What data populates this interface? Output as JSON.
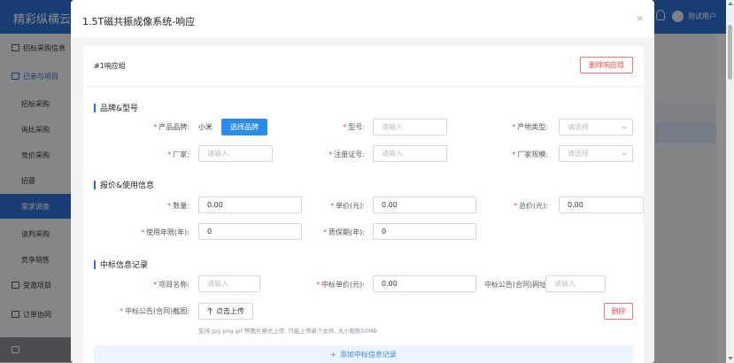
{
  "app": {
    "brand": "精彩纵横云采",
    "user": "测试用户"
  },
  "sidebar": {
    "items": [
      {
        "label": "招标采购信息"
      },
      {
        "label": "已参与项目"
      },
      {
        "label": "招标采购"
      },
      {
        "label": "询比采购"
      },
      {
        "label": "竞价采购"
      },
      {
        "label": "招募"
      },
      {
        "label": "需求调查"
      },
      {
        "label": "谈判采购"
      },
      {
        "label": "竞争销售"
      },
      {
        "label": "受邀项目"
      },
      {
        "label": "订单协同"
      }
    ]
  },
  "modal": {
    "title": "1.5T磁共振成像系统-响应",
    "close": "×",
    "group_title": "#1响应组",
    "delete_group": "删除响应组",
    "brand_section": {
      "title": "品牌&型号",
      "brand_label": "产品品牌:",
      "brand_value": "小米",
      "select_brand": "选择品牌",
      "model_label": "型号:",
      "model_placeholder": "请输入",
      "origin_label": "产地类型:",
      "origin_placeholder": "请选择",
      "maker_label": "厂家:",
      "maker_placeholder": "请输入",
      "reg_label": "注册证号:",
      "reg_placeholder": "请输入",
      "scale_label": "厂家规模:",
      "scale_placeholder": "请选择"
    },
    "price_section": {
      "title": "报价&使用信息",
      "qty_label": "数量:",
      "qty_value": "0.00",
      "unit_label": "单价(元):",
      "unit_value": "0.00",
      "total_label": "总价(元):",
      "total_value": "0.00",
      "life_label": "使用年限(年):",
      "life_value": "0",
      "warranty_label": "质保期(年):",
      "warranty_value": "0"
    },
    "award_section": {
      "title": "中标信息记录",
      "project_label": "项目名称:",
      "project_placeholder": "请输入",
      "price_label": "中标单价(元):",
      "price_value": "0.00",
      "url_label": "中标公告(合同)网址:",
      "url_placeholder": "请输入",
      "screenshot_label": "中标公告(合同)截图:",
      "upload": "点击上传",
      "hint": "支持 jpg png gif 等图片格式上传, 只能上传单个文件, 大小限制50MB",
      "delete": "删除",
      "add_record": "添加中标信息记录",
      "add_icon": "+"
    }
  }
}
